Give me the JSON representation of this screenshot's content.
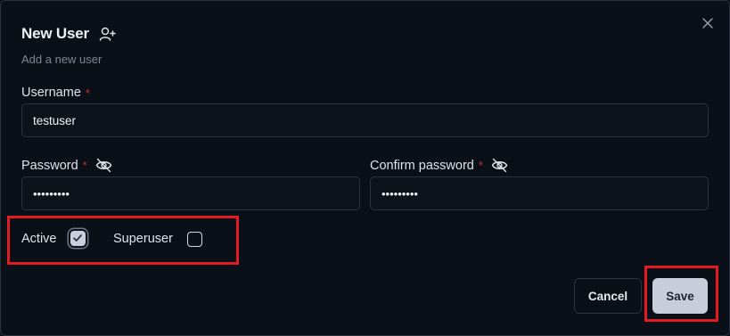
{
  "dialog": {
    "title": "New User",
    "title_icon": "user-plus-icon",
    "subtitle": "Add a new user",
    "close_icon": "close-icon"
  },
  "fields": {
    "username": {
      "label": "Username",
      "required_mark": "*",
      "value": "testuser"
    },
    "password": {
      "label": "Password",
      "required_mark": "*",
      "value": "•••••••••",
      "toggle_icon": "eye-off-icon"
    },
    "confirm_password": {
      "label": "Confirm password",
      "required_mark": "*",
      "value": "•••••••••",
      "toggle_icon": "eye-off-icon"
    }
  },
  "checkboxes": {
    "active": {
      "label": "Active",
      "checked": true
    },
    "superuser": {
      "label": "Superuser",
      "checked": false
    }
  },
  "actions": {
    "cancel_label": "Cancel",
    "save_label": "Save"
  },
  "colors": {
    "background": "#0b0f17",
    "highlight": "#e31b23",
    "required": "#c0392b",
    "save_button": "#c7ced9"
  }
}
